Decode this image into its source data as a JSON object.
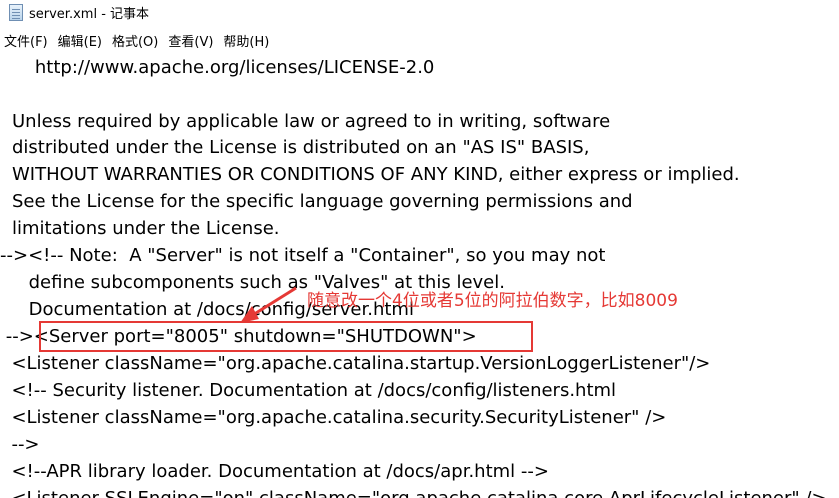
{
  "window": {
    "title": "server.xml - 记事本",
    "icon": "notepad-icon"
  },
  "menu": {
    "file": "文件(F)",
    "edit": "编辑(E)",
    "format": "格式(O)",
    "view": "查看(V)",
    "help": "帮助(H)"
  },
  "lines": [
    "    http://www.apache.org/licenses/LICENSE-2.0",
    "",
    "Unless required by applicable law or agreed to in writing, software",
    "distributed under the License is distributed on an \"AS IS\" BASIS,",
    "WITHOUT WARRANTIES OR CONDITIONS OF ANY KIND, either express or implied.",
    "See the License for the specific language governing permissions and",
    "limitations under the License.",
    "--><!-- Note:  A \"Server\" is not itself a \"Container\", so you may not",
    "     define subcomponents such as \"Valves\" at this level.",
    "     Documentation at /docs/config/server.html",
    " --><Server port=\"8005\" shutdown=\"SHUTDOWN\">",
    "  <Listener className=\"org.apache.catalina.startup.VersionLoggerListener\"/>",
    "  <!-- Security listener. Documentation at /docs/config/listeners.html",
    "  <Listener className=\"org.apache.catalina.security.SecurityListener\" />",
    "  -->",
    "  <!--APR library loader. Documentation at /docs/apr.html -->",
    "  <Listener SSLEngine=\"on\" className=\"org.apache.catalina.core.AprLifecycleListener\" />"
  ],
  "annotation": {
    "text": "随意改一个4位或者5位的阿拉伯数字，比如8009",
    "color": "#e53935"
  }
}
